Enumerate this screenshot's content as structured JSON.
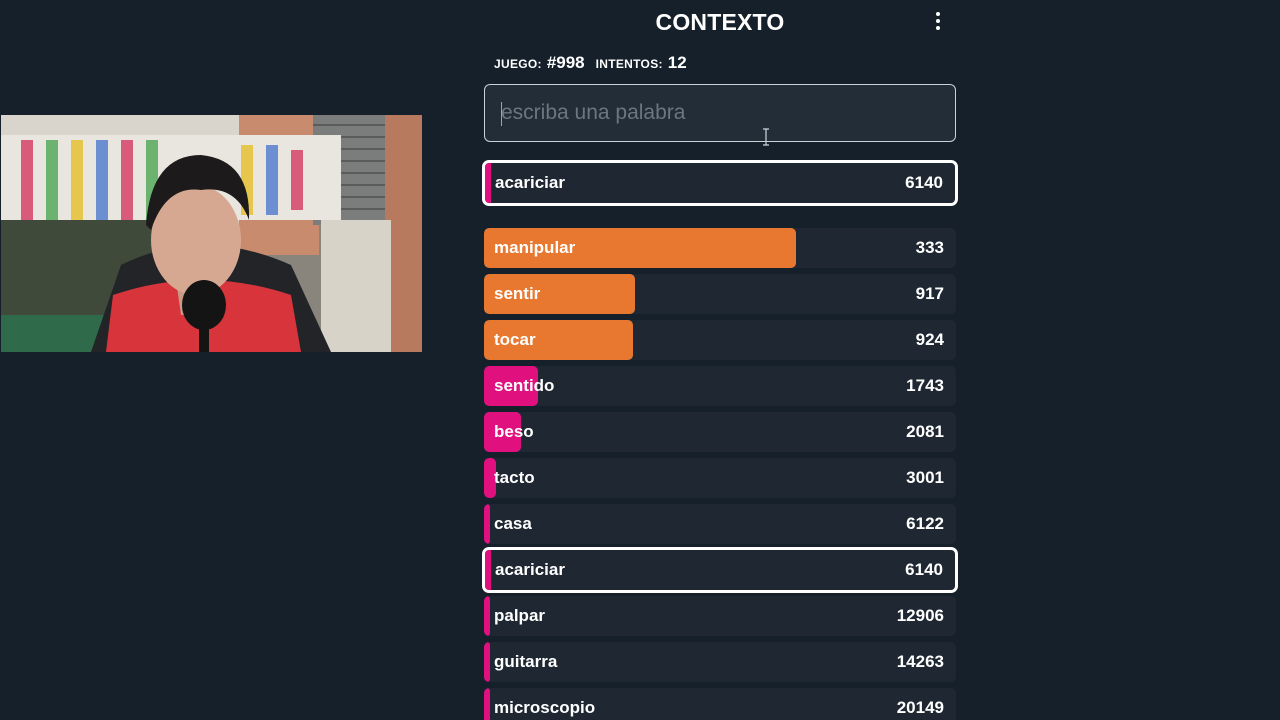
{
  "header": {
    "title": "CONTEXTO",
    "menu_icon": "vertical-dots-icon"
  },
  "stats": {
    "game_label": "JUEGO:",
    "game_value": "#998",
    "attempts_label": "INTENTOS:",
    "attempts_value": "12"
  },
  "search": {
    "placeholder": "escriba una palabra",
    "value": ""
  },
  "current_guess": {
    "word": "acariciar",
    "rank": "6140",
    "bar_fill": 0.007
  },
  "guesses": [
    {
      "word": "manipular",
      "rank": "333",
      "bar_fill": 0.66,
      "color": "#e8782f"
    },
    {
      "word": "sentir",
      "rank": "917",
      "bar_fill": 0.32,
      "color": "#e8782f"
    },
    {
      "word": "tocar",
      "rank": "924",
      "bar_fill": 0.315,
      "color": "#e8782f"
    },
    {
      "word": "sentido",
      "rank": "1743",
      "bar_fill": 0.115,
      "color": "#e0117f"
    },
    {
      "word": "beso",
      "rank": "2081",
      "bar_fill": 0.078,
      "color": "#e0117f"
    },
    {
      "word": "tacto",
      "rank": "3001",
      "bar_fill": 0.025,
      "color": "#e0117f"
    },
    {
      "word": "casa",
      "rank": "6122",
      "bar_fill": 0.008,
      "color": "#e0117f"
    },
    {
      "word": "acariciar",
      "rank": "6140",
      "bar_fill": 0.007,
      "color": "#e0117f",
      "highlighted": true
    },
    {
      "word": "palpar",
      "rank": "12906",
      "bar_fill": 0.006,
      "color": "#e0117f"
    },
    {
      "word": "guitarra",
      "rank": "14263",
      "bar_fill": 0.006,
      "color": "#e0117f"
    },
    {
      "word": "microscopio",
      "rank": "20149",
      "bar_fill": 0.006,
      "color": "#e0117f"
    }
  ],
  "colors": {
    "background": "#15202b",
    "row_background": "#1e2732",
    "close": "#e8782f",
    "far": "#e0117f"
  }
}
